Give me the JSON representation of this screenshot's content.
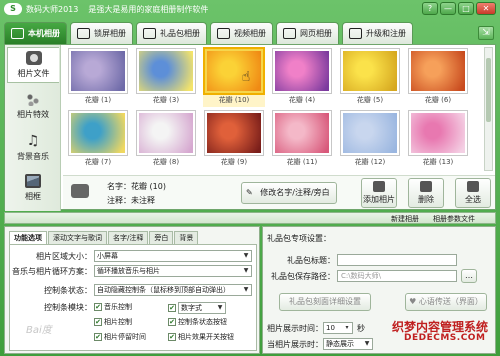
{
  "window": {
    "logo_text": "S",
    "title": "数码大师2013",
    "slogan": "是强大是易用的家庭相册制作软件",
    "controls": [
      "?",
      "—",
      "□",
      "✕"
    ]
  },
  "tabs": [
    {
      "label": "本机相册",
      "icon": "camera-icon",
      "active": true
    },
    {
      "label": "锁屏相册",
      "icon": "monitor-icon",
      "active": false
    },
    {
      "label": "礼品包相册",
      "icon": "gift-icon",
      "active": false
    },
    {
      "label": "视频相册",
      "icon": "film-icon",
      "active": false
    },
    {
      "label": "网页相册",
      "icon": "ie-icon",
      "active": false
    },
    {
      "label": "升级和注册",
      "icon": "key-icon",
      "active": false
    }
  ],
  "sidebar": [
    {
      "label": "相片文件",
      "icon": "camera-icon",
      "active": true
    },
    {
      "label": "相片特效",
      "icon": "effects-icon",
      "active": false
    },
    {
      "label": "背景音乐",
      "icon": "music-note-icon",
      "active": false
    },
    {
      "label": "相框",
      "icon": "frame-icon",
      "active": false
    }
  ],
  "photos": [
    {
      "caption": "花瓣 (1)",
      "colors": [
        "#b8a9d6",
        "#6e6aa8"
      ],
      "selected": false
    },
    {
      "caption": "花瓣 (3)",
      "colors": [
        "#5d8fd8",
        "#f4e46a"
      ],
      "selected": false
    },
    {
      "caption": "花瓣 (10)",
      "colors": [
        "#fbd236",
        "#f08a14"
      ],
      "selected": true
    },
    {
      "caption": "花瓣 (4)",
      "colors": [
        "#f080c8",
        "#7b3a9e"
      ],
      "selected": false
    },
    {
      "caption": "花瓣 (5)",
      "colors": [
        "#fbe24a",
        "#d6a820"
      ],
      "selected": false
    },
    {
      "caption": "花瓣 (6)",
      "colors": [
        "#f6a05a",
        "#c84a1e"
      ],
      "selected": false
    },
    {
      "caption": "花瓣 (7)",
      "colors": [
        "#3ea0c8",
        "#f0d860"
      ],
      "selected": false
    },
    {
      "caption": "花瓣 (8)",
      "colors": [
        "#f4f4f4",
        "#d6a8d0"
      ],
      "selected": false
    },
    {
      "caption": "花瓣 (9)",
      "colors": [
        "#e0603a",
        "#7a1e1a"
      ],
      "selected": false
    },
    {
      "caption": "花瓣 (11)",
      "colors": [
        "#f4b8c8",
        "#d8587a"
      ],
      "selected": false
    },
    {
      "caption": "花瓣 (12)",
      "colors": [
        "#c8d6ee",
        "#9ab6e0"
      ],
      "selected": false
    },
    {
      "caption": "花瓣 (13)",
      "colors": [
        "#e878b0",
        "#f4d0e4"
      ],
      "selected": false
    }
  ],
  "info": {
    "name_label": "名字：花瓣",
    "name_count": "(10)",
    "note_label": "注释：未注释",
    "edit_button": "修改名字/注释/旁白",
    "add_button": "添加相片",
    "delete_button": "删除",
    "select_all_button": "全选"
  },
  "subbar": {
    "new_album": "新建相册",
    "album_params": "相册参数文件"
  },
  "left_panel": {
    "tabs": [
      "功能选项",
      "滚动文字与歌词",
      "名字/注释",
      "旁白",
      "背景"
    ],
    "area_size_label": "相片区域大小：",
    "area_size_value": "小屏幕",
    "loop_label": "音乐与相片循环方案：",
    "loop_value": "循环播放音乐与相片",
    "control_bar_label": "控制条状态：",
    "control_bar_value": "自动隐藏控制条（鼠标移到顶部自动弹出）",
    "control_module_label": "控制条模块：",
    "checks": [
      {
        "label": "音乐控制",
        "checked": true
      },
      {
        "label": "数字式",
        "checked": true,
        "dropdown": true
      },
      {
        "label": "相片控制",
        "checked": true
      },
      {
        "label": "控制条状态按钮",
        "checked": true
      },
      {
        "label": "相片停留时间",
        "checked": true
      },
      {
        "label": "相片效果开关按钮",
        "checked": true
      }
    ],
    "watermark": "Bai度"
  },
  "right_panel": {
    "title": "礼品包专项设置：",
    "gift_title_label": "礼品包标题：",
    "gift_title_value": "",
    "gift_path_label": "礼品包保存路径：",
    "gift_path_value": "C:\\数码大师\\",
    "browse_label": "…",
    "make_button": "礼品包刻面详细设置",
    "preview_button": "心语传送（界面）",
    "interval_label": "相片展示时间：",
    "interval_value": "10",
    "interval_unit": "秒",
    "display_mode_label": "当相片展示时：",
    "display_mode_value": "静态展示",
    "brand_text": "织梦内容管理系统",
    "brand_url": "DEDECMS.COM"
  }
}
